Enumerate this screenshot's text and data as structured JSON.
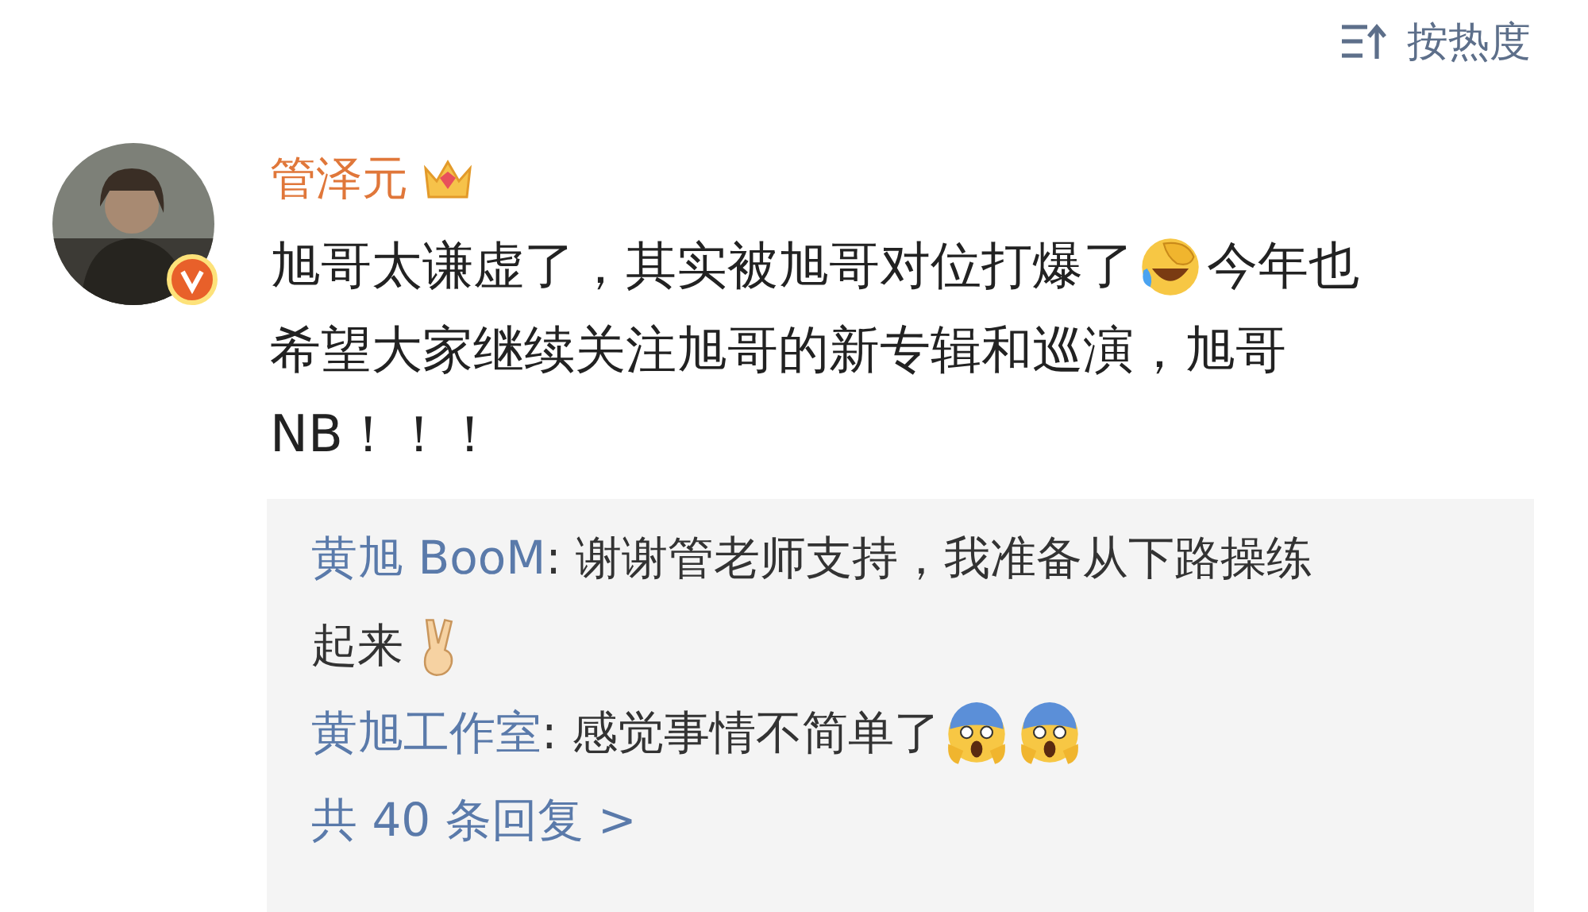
{
  "sort": {
    "label": "按热度"
  },
  "comment": {
    "author": "管泽元",
    "verified": true,
    "crown": true,
    "lines": [
      [
        {
          "kind": "text",
          "text": "旭哥太谦虚了，其实被旭哥对位打爆了"
        },
        {
          "kind": "laugh"
        },
        {
          "kind": "text",
          "text": "今年也"
        }
      ],
      [
        {
          "kind": "text",
          "text": "希望大家继续关注旭哥的新专辑和巡演，旭哥"
        }
      ],
      [
        {
          "kind": "text",
          "text": "NB！！！"
        }
      ]
    ],
    "replies": [
      {
        "author": "黄旭 BooM",
        "lines": [
          [
            {
              "kind": "text",
              "text": ": 谢谢管老师支持，我准备从下路操练"
            }
          ],
          [
            {
              "kind": "text",
              "text": "起来"
            },
            {
              "kind": "peace"
            }
          ]
        ]
      },
      {
        "author": "黄旭工作室",
        "lines": [
          [
            {
              "kind": "text",
              "text": ": 感觉事情不简单了"
            },
            {
              "kind": "scream"
            },
            {
              "kind": "scream"
            }
          ]
        ]
      }
    ],
    "more": "共 40 条回复 >"
  }
}
